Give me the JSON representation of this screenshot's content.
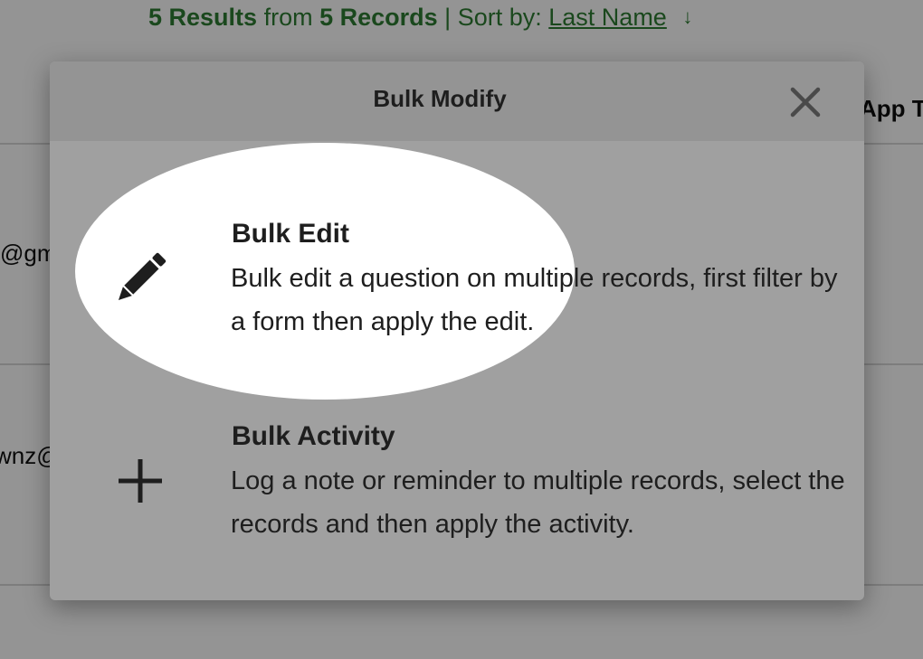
{
  "background": {
    "results": {
      "count": "5 Results",
      "from_word": "from",
      "records": "5 Records",
      "separator": "|",
      "sort_label": "Sort by:",
      "sort_value": "Last Name",
      "sort_arrow": "↓"
    },
    "column_header_partial": "App T",
    "rows": [
      {
        "email_partial": "@gm"
      },
      {
        "email_partial": "wnz@"
      }
    ]
  },
  "modal": {
    "title": "Bulk Modify",
    "close_icon": "close-icon",
    "options": [
      {
        "icon": "pencil-icon",
        "title": "Bulk Edit",
        "description": "Bulk edit a question on multiple records, first filter by a form then apply the edit."
      },
      {
        "icon": "plus-icon",
        "title": "Bulk Activity",
        "description": "Log a note or reminder to multiple records, select the records and then apply the activity."
      }
    ]
  },
  "colors": {
    "results_green": "#2e7d32",
    "modal_body": "#a0a0a0",
    "modal_header": "#949494",
    "text_dark": "#1e1e1e",
    "spotlight": "#ffffff"
  }
}
